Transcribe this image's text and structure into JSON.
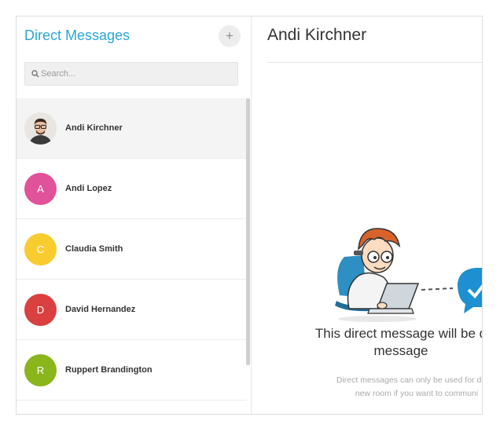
{
  "sidebar": {
    "title": "Direct Messages",
    "add_button_label": "+",
    "search": {
      "placeholder": "Search...",
      "value": ""
    },
    "conversations": [
      {
        "name": "Andi Kirchner",
        "avatar_type": "photo",
        "active": true
      },
      {
        "name": "Andi Lopez",
        "initial": "A",
        "avatar_color": "#e0529a"
      },
      {
        "name": "Claudia Smith",
        "initial": "C",
        "avatar_color": "#f8cb2e"
      },
      {
        "name": "David Hernandez",
        "initial": "D",
        "avatar_color": "#d9403f"
      },
      {
        "name": "Ruppert Brandington",
        "initial": "R",
        "avatar_color": "#8ab61c"
      }
    ]
  },
  "main": {
    "title": "Andi Kirchner",
    "empty_state": {
      "title_line1": "This direct message will be d",
      "title_line2": "message",
      "subtitle_line1": "Direct messages can only be used for direct",
      "subtitle_line2": "new room if you want to communi"
    }
  },
  "colors": {
    "accent": "#2aa6d6",
    "check_bubble": "#1e8fd0"
  }
}
